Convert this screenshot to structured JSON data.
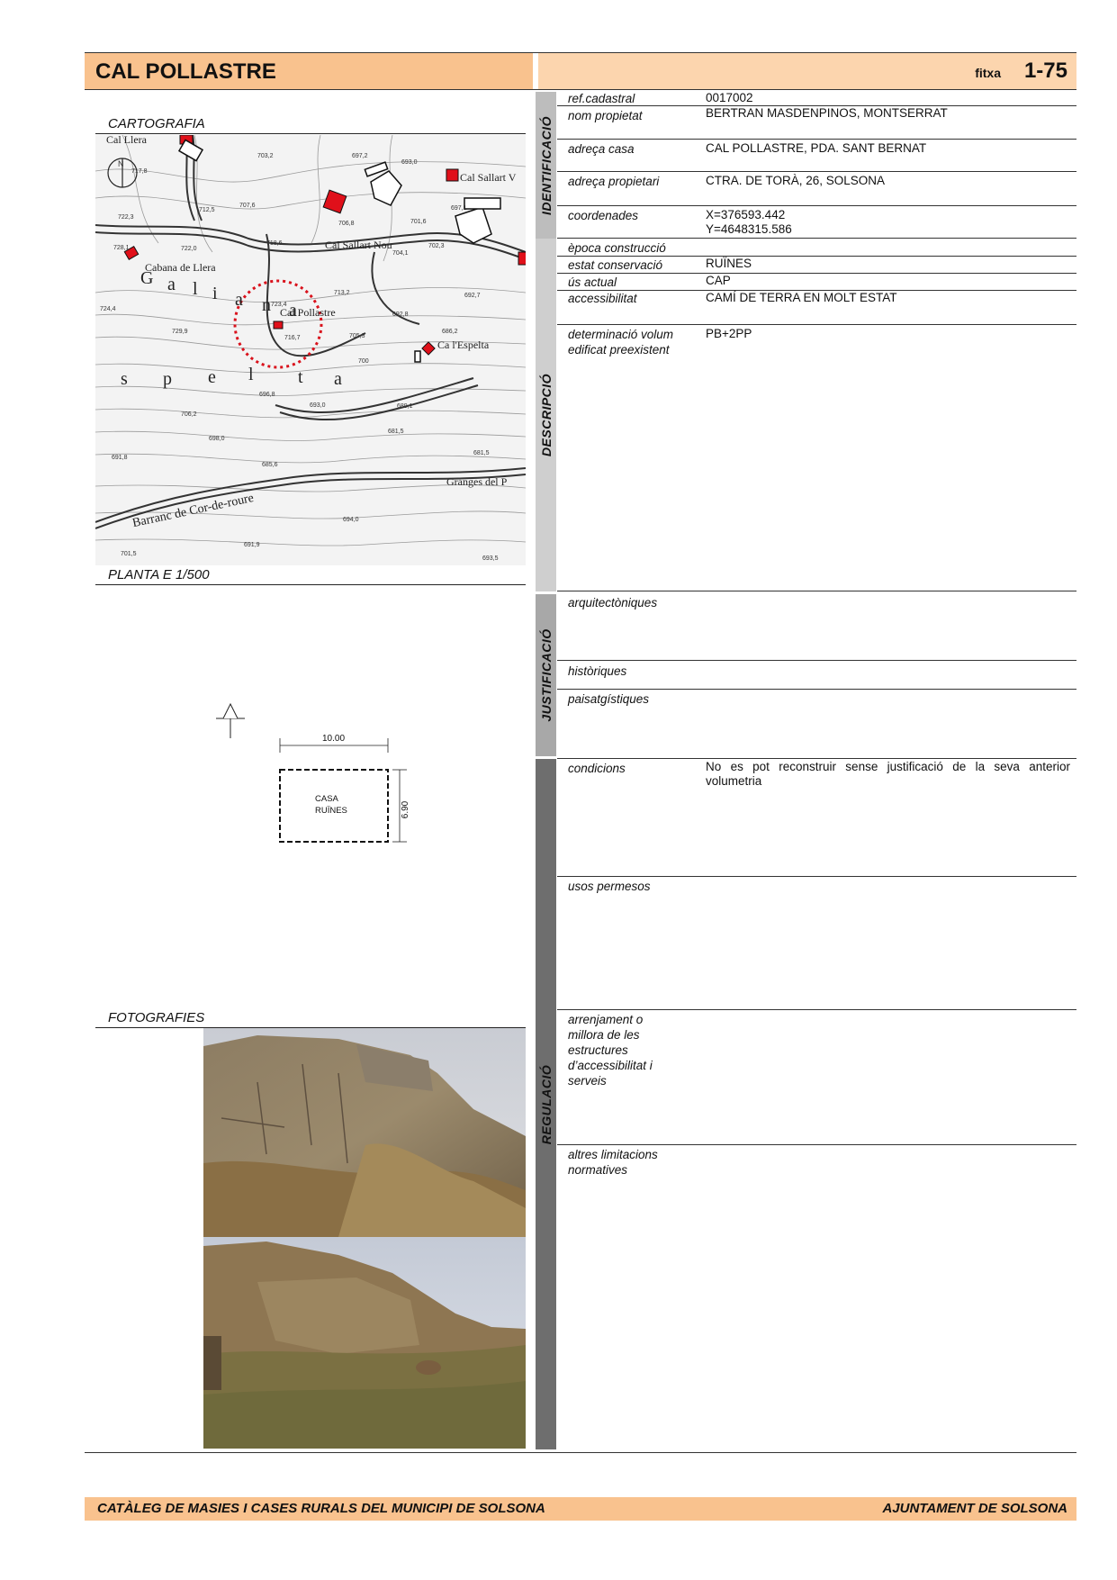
{
  "header": {
    "title": "CAL POLLASTRE",
    "fitxa_label": "fitxa",
    "fitxa_number": "1-75"
  },
  "left": {
    "cartografia_title": "CARTOGRAFIA",
    "planta_title": "PLANTA E 1/500",
    "fotografies_title": "FOTOGRAFIES"
  },
  "map": {
    "place_labels": [
      "Cal Llera",
      "Cal Sallart V",
      "Cal Sallart Nou",
      "Cabana de Llera",
      "Cal Pollastre",
      "Ca l'Espelta",
      "Granges del P",
      "Barranc de Cor-de-roure"
    ],
    "big_letters": [
      "G",
      "a",
      "l",
      "i",
      "a",
      "n",
      "a",
      "s",
      "p",
      "e",
      "l",
      "t",
      "a"
    ],
    "spot_heights": [
      "703,2",
      "697,2",
      "693,0",
      "717,8",
      "722,3",
      "712,5",
      "707,6",
      "706,8",
      "701,6",
      "697,1",
      "718,6",
      "728,1",
      "722,0",
      "704,1",
      "702,3",
      "724,4",
      "723,4",
      "713,2",
      "692,7",
      "729,9",
      "716,7",
      "705,3",
      "692,8",
      "686,2",
      "700",
      "696,8",
      "693,0",
      "689,1",
      "706,2",
      "698,0",
      "681,5",
      "691,8",
      "685,6",
      "681,5",
      "694,0",
      "691,9",
      "701,5",
      "693,5"
    ],
    "north_label": "N"
  },
  "plan": {
    "width_dim": "10.00",
    "height_dim": "6.90",
    "building_label_1": "CASA",
    "building_label_2": "RUÏNES"
  },
  "sections": {
    "identificacio": "IDENTIFICACIÓ",
    "descripcio": "DESCRIPCIÓ",
    "justificacio": "JUSTIFICACIÓ",
    "regulacio": "REGULACIÓ"
  },
  "fields": {
    "ref_cadastral": {
      "label": "ref.cadastral",
      "value": "0017002"
    },
    "nom_propietat": {
      "label": "nom propietat",
      "value": "BERTRAN MASDENPINOS, MONTSERRAT"
    },
    "adreca_casa": {
      "label": "adreça casa",
      "value": "CAL POLLASTRE, PDA. SANT BERNAT"
    },
    "adreca_propietari": {
      "label": "adreça propietari",
      "value": "CTRA. DE TORÀ, 26, SOLSONA"
    },
    "coordenades": {
      "label": "coordenades",
      "value": "X=376593.442\nY=4648315.586"
    },
    "epoca_construccio": {
      "label": "època construcció",
      "value": ""
    },
    "estat_conservacio": {
      "label": "estat conservació",
      "value": "RUÏNES"
    },
    "us_actual": {
      "label": "ús actual",
      "value": "CAP"
    },
    "accessibilitat": {
      "label": "accessibilitat",
      "value": "CAMÍ DE TERRA EN MOLT ESTAT"
    },
    "determinacio_volum": {
      "label": "determinació volum edificat preexistent",
      "value": "PB+2PP"
    },
    "arquitectoniques": {
      "label": "arquitectòniques",
      "value": ""
    },
    "historiques": {
      "label": "històriques",
      "value": ""
    },
    "paisatgistiques": {
      "label": "paisatgístiques",
      "value": ""
    },
    "condicions": {
      "label": "condicions",
      "value": "No es pot reconstruir sense justificació de la seva anterior volumetria"
    },
    "usos_permesos": {
      "label": "usos permesos",
      "value": ""
    },
    "arrenjament": {
      "label": "arrenjament o millora de les estructures d’accessibilitat i serveis",
      "value": ""
    },
    "altres_limitacions": {
      "label": "altres limitacions normatives",
      "value": ""
    }
  },
  "footer": {
    "left": "CATÀLEG DE MASIES I CASES RURALS DEL MUNICIPI DE SOLSONA",
    "right": "AJUNTAMENT DE SOLSONA"
  },
  "colors": {
    "header_orange": "#f9c28e",
    "header_light": "#fcd5ae",
    "bar_identificacio": "#bdbdbd",
    "bar_descripcio": "#cfcfcf",
    "bar_justificacio": "#a8a8a8",
    "bar_regulacio": "#6e6e6e",
    "map_building_red": "#e0101a"
  }
}
